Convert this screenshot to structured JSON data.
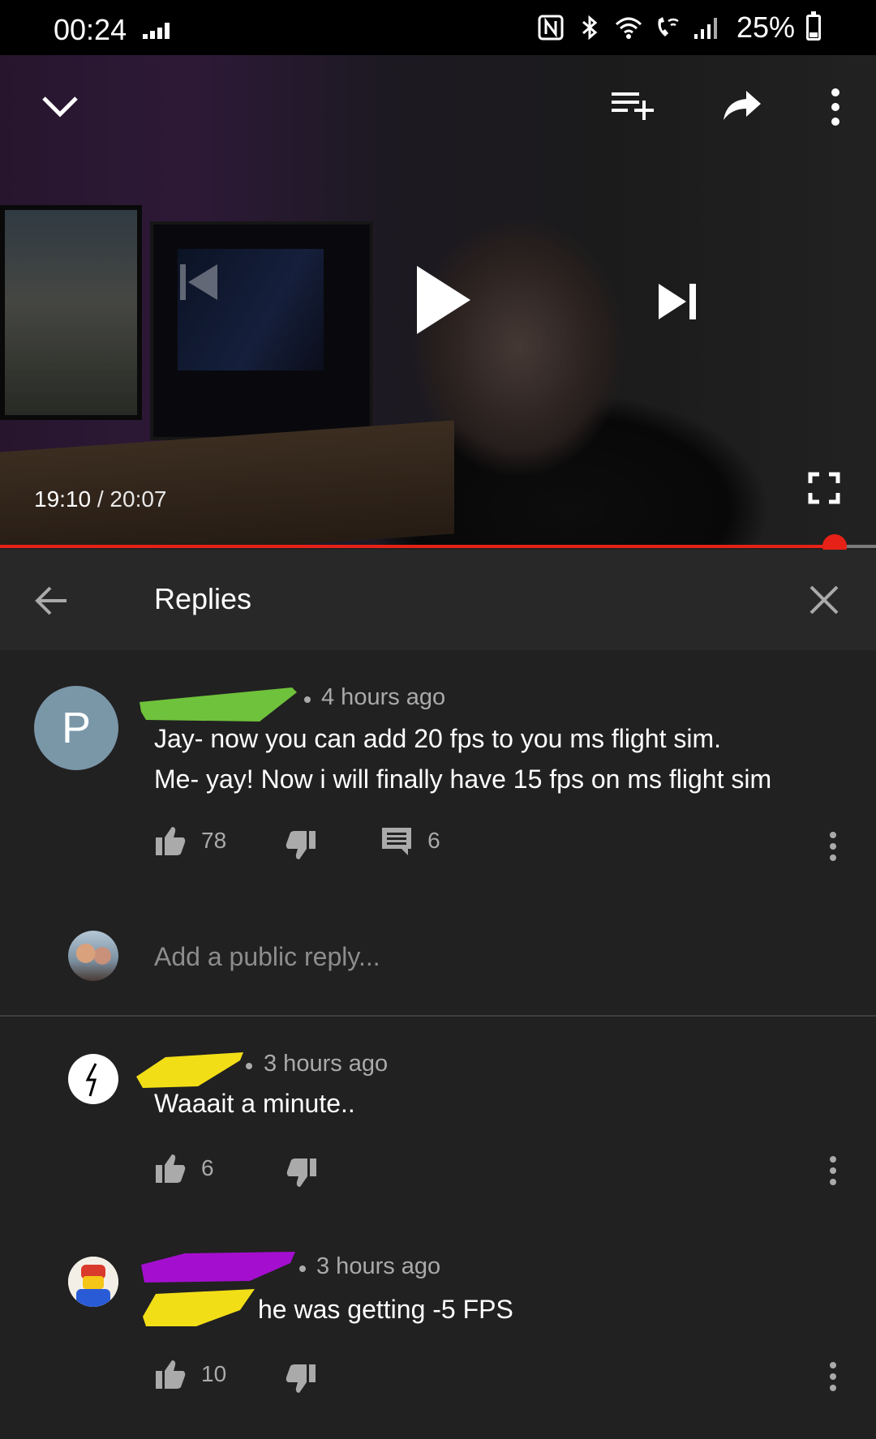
{
  "status_bar": {
    "time": "00:24",
    "battery": "25%",
    "battery_level": 0.25,
    "icons": [
      "signal-dots-icon",
      "nfc-icon",
      "bluetooth-icon",
      "wifi-icon",
      "wifi-calling-icon",
      "cell-signal-icon",
      "battery-icon"
    ]
  },
  "video": {
    "current_time": "19:10",
    "separator": " / ",
    "duration": "20:07",
    "progress": 0.953,
    "icons": [
      "collapse-chevron-icon",
      "add-to-queue-icon",
      "share-icon",
      "more-vert-icon",
      "previous-icon",
      "play-icon",
      "next-icon",
      "fullscreen-icon"
    ]
  },
  "replies_panel": {
    "title": "Replies",
    "back_icon": "arrow-back-icon",
    "close_icon": "close-icon"
  },
  "main_comment": {
    "avatar_letter": "P",
    "avatar_color": "#7a97a8",
    "author_scribble_color": "#6fc23b",
    "time": "4 hours ago",
    "lines": [
      "Jay- now you can add 20 fps to you ms flight sim.",
      "Me- yay! Now i will finally have 15 fps on ms flight sim"
    ],
    "likes": "78",
    "replies": "6"
  },
  "reply_box": {
    "placeholder": "Add a public reply..."
  },
  "replies": [
    {
      "author_scribble_color": "#f2de17",
      "time": "3 hours ago",
      "text": "Waaait a minute..",
      "likes": "6"
    },
    {
      "author_scribble_color": "#a40fcf",
      "mention_scribble_color": "#f2de17",
      "time": "3 hours ago",
      "text": "he was getting -5 FPS",
      "likes": "10"
    }
  ],
  "colors": {
    "background": "#212121",
    "header_bg": "#282828",
    "progress": "#e62117",
    "secondary_text": "#aaaaaa"
  }
}
